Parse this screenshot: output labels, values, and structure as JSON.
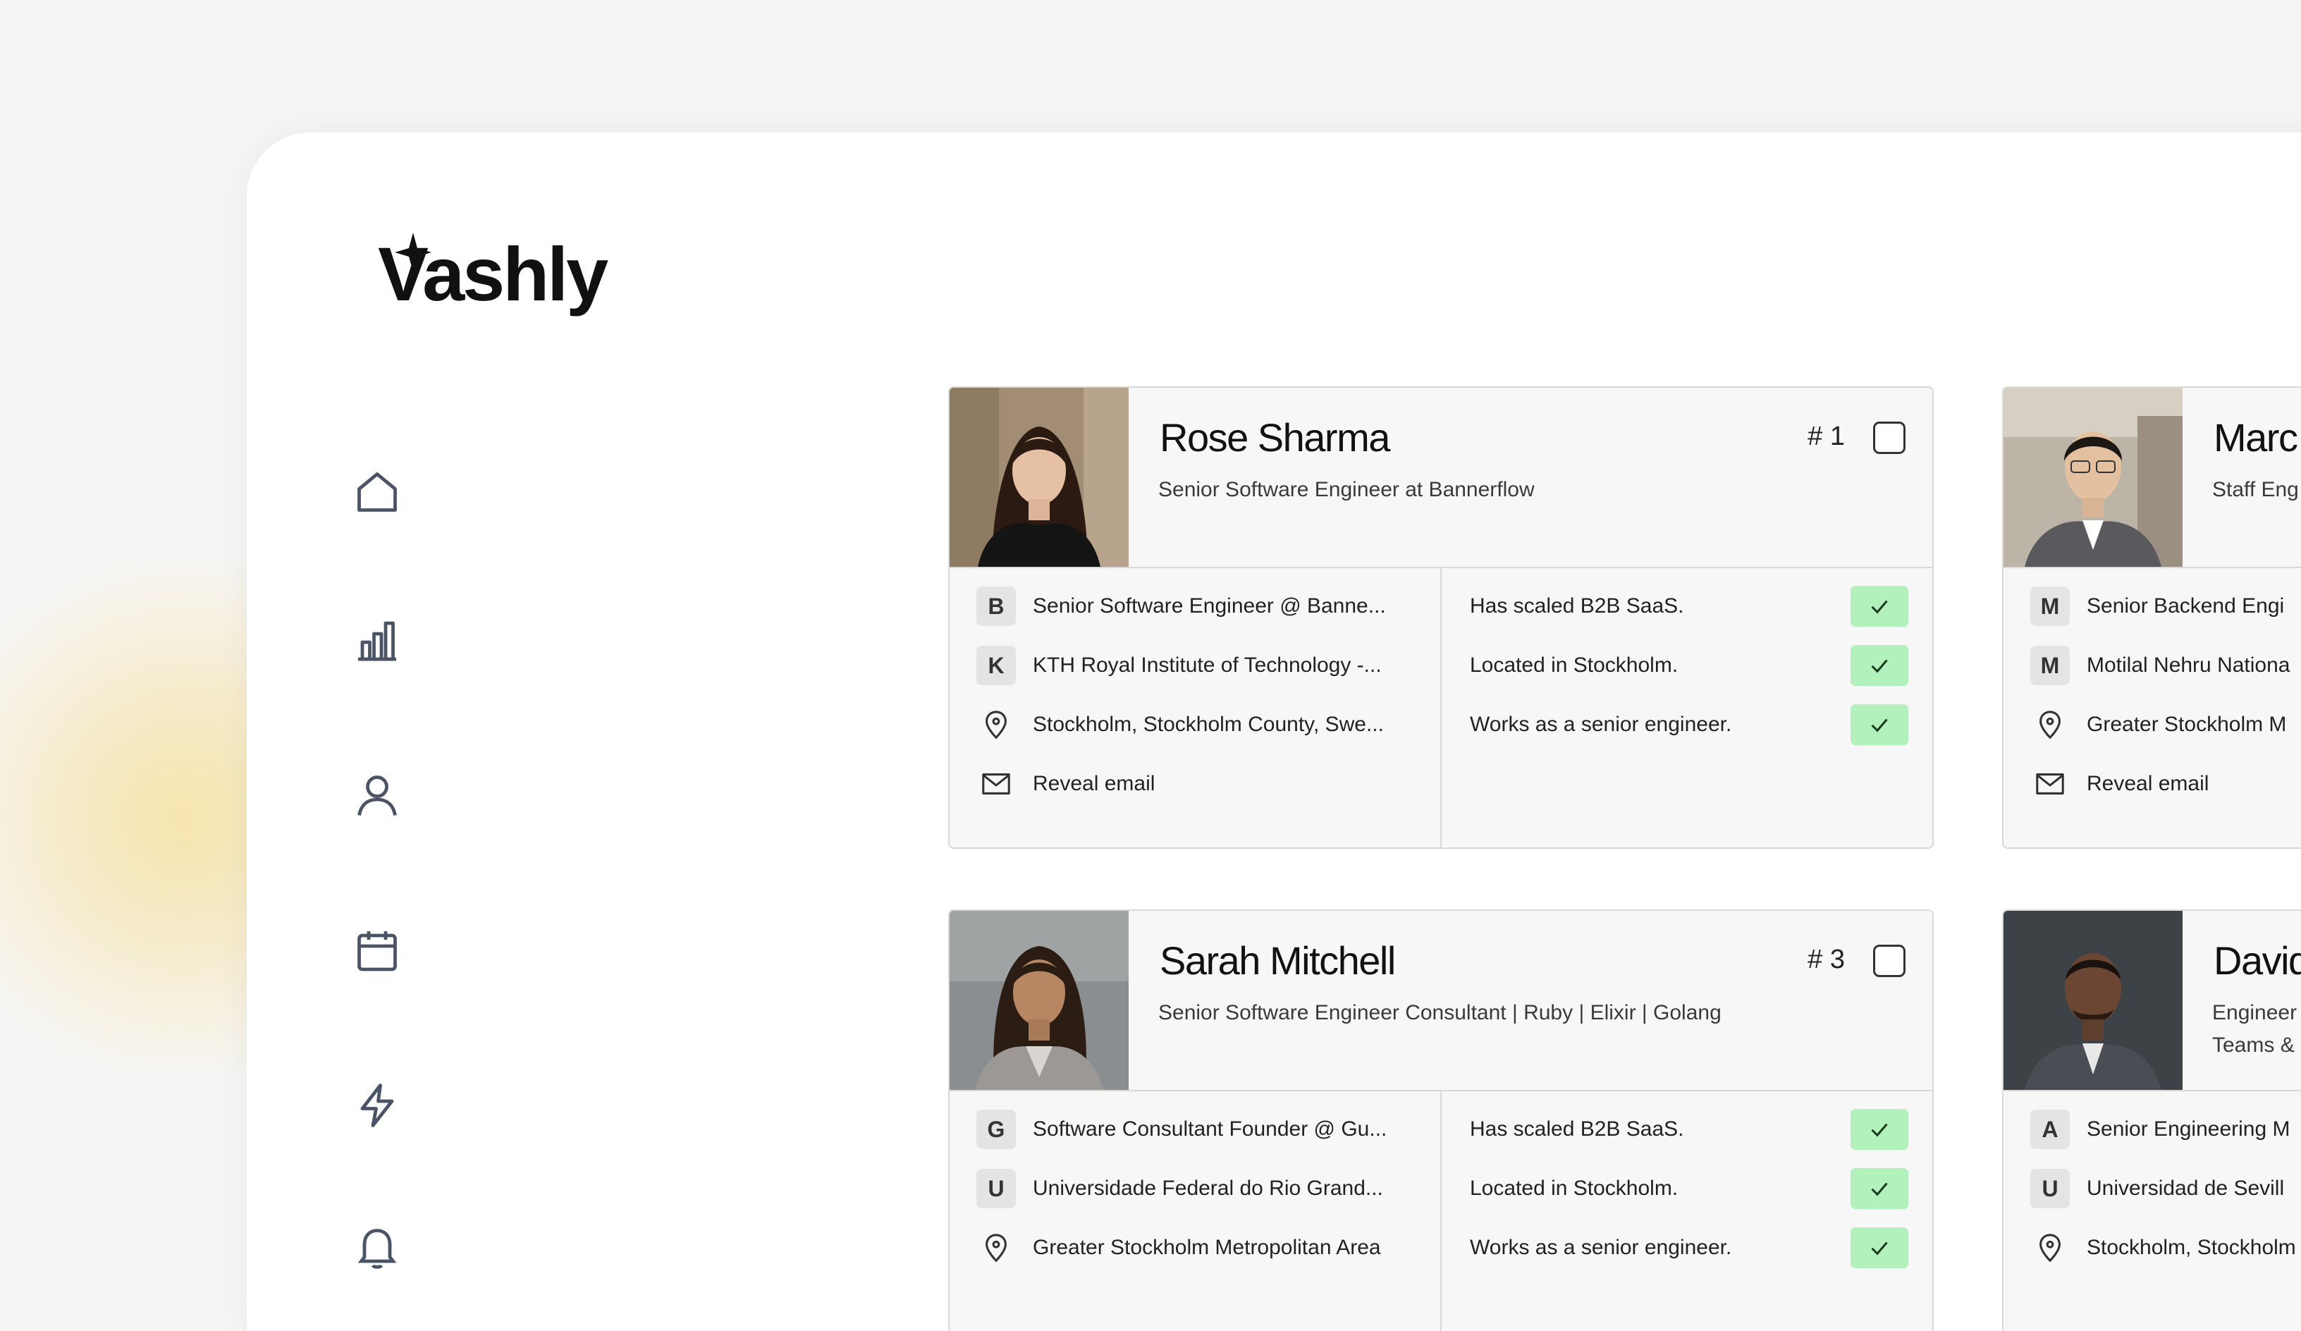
{
  "app": {
    "brand": "Vashly"
  },
  "nav": [
    {
      "icon": "home-icon"
    },
    {
      "icon": "bar-chart-icon"
    },
    {
      "icon": "user-icon"
    },
    {
      "icon": "calendar-icon"
    },
    {
      "icon": "lightning-icon"
    },
    {
      "icon": "bell-icon"
    }
  ],
  "colors": {
    "check_bg": "#b3f1bc",
    "badge_bg": "#e4e4e4",
    "card_bg": "#f7f7f7",
    "glow": "#f6e2a0"
  },
  "cards": [
    {
      "name": "Rose Sharma",
      "rank": "# 1",
      "subtitle": "Senior Software Engineer at Bannerflow",
      "info": [
        {
          "badge": "B",
          "text": "Senior Software Engineer @ Banne..."
        },
        {
          "badge": "K",
          "text": "KTH Royal Institute of Technology -..."
        },
        {
          "icon": "location-pin-icon",
          "text": "Stockholm, Stockholm County, Swe..."
        },
        {
          "icon": "mail-icon",
          "text": "Reveal email"
        }
      ],
      "criteria": [
        "Has scaled B2B SaaS.",
        "Located in Stockholm.",
        "Works as a senior engineer."
      ]
    },
    {
      "name": "Marc",
      "subtitle": "Staff Eng",
      "info": [
        {
          "badge": "M",
          "text": "Senior Backend Engi"
        },
        {
          "badge": "M",
          "text": "Motilal Nehru Nationa"
        },
        {
          "icon": "location-pin-icon",
          "text": "Greater Stockholm M"
        },
        {
          "icon": "mail-icon",
          "text": "Reveal email"
        }
      ]
    },
    {
      "name": "Sarah Mitchell",
      "rank": "# 3",
      "subtitle": "Senior Software Engineer Consultant | Ruby | Elixir | Golang",
      "info": [
        {
          "badge": "G",
          "text": "Software Consultant Founder @ Gu..."
        },
        {
          "badge": "U",
          "text": "Universidade Federal do Rio Grand..."
        },
        {
          "icon": "location-pin-icon",
          "text": "Greater Stockholm Metropolitan Area"
        }
      ],
      "criteria": [
        "Has scaled B2B SaaS.",
        "Located in Stockholm.",
        "Works as a senior engineer."
      ]
    },
    {
      "name": "David",
      "subtitle": "Engineer Teams &",
      "info": [
        {
          "badge": "A",
          "text": "Senior Engineering M"
        },
        {
          "badge": "U",
          "text": "Universidad de Sevill"
        },
        {
          "icon": "location-pin-icon",
          "text": "Stockholm, Stockholm"
        }
      ]
    }
  ]
}
